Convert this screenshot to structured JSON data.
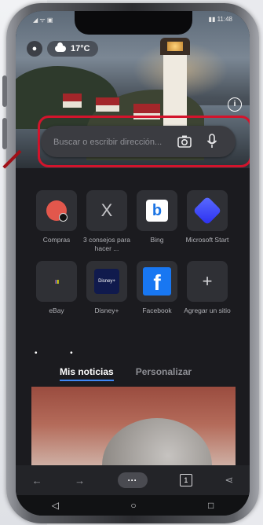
{
  "status": {
    "left": "◢ ᯤ ▣",
    "right": "▮▮ 11:48"
  },
  "header": {
    "temperature": "17°C"
  },
  "search": {
    "placeholder": "Buscar o escribir dirección..."
  },
  "tiles": [
    {
      "label": "Compras"
    },
    {
      "label": "3 consejos para hacer ..."
    },
    {
      "label": "Bing"
    },
    {
      "label": "Microsoft Start"
    },
    {
      "label": "eBay"
    },
    {
      "label": "Disney+"
    },
    {
      "label": "Facebook"
    },
    {
      "label": "Agregar un sitio"
    }
  ],
  "tile_glyphs": {
    "x": "X",
    "plus": "+",
    "bing": "b",
    "facebook": "f",
    "disney": "Disney+"
  },
  "news_tabs": [
    {
      "label": "Mis noticias"
    },
    {
      "label": "Personalizar"
    }
  ],
  "toolbar": {
    "tab_count": "1",
    "menu": "···"
  },
  "accent": {
    "search_highlight": "#d3142c",
    "active_tab": "#3f87f5"
  }
}
